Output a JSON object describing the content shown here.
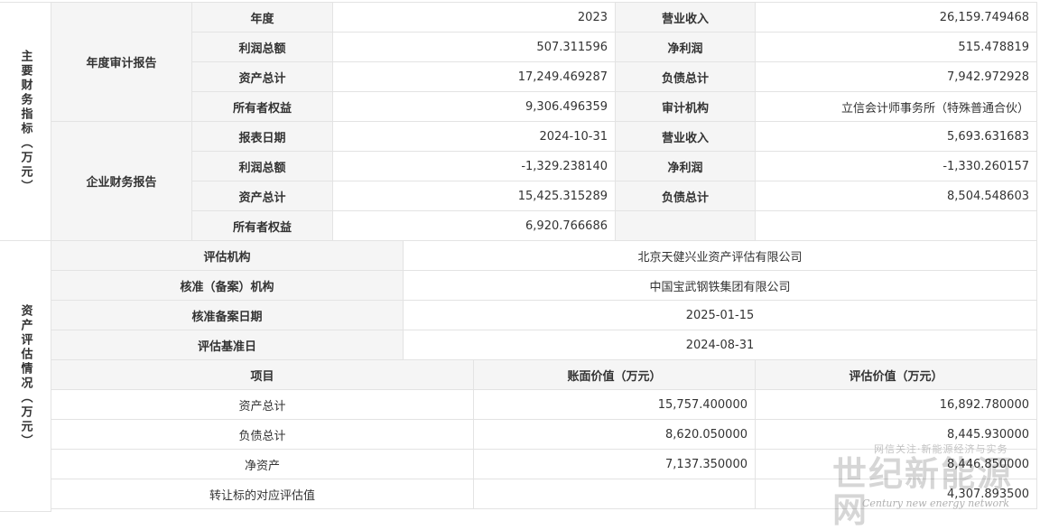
{
  "financial": {
    "group_label": "主要财务指标（万元）",
    "annual": {
      "label": "年度审计报告",
      "rows": [
        {
          "k1": "年度",
          "v1": "2023",
          "k2": "营业收入",
          "v2": "26,159.749468"
        },
        {
          "k1": "利润总额",
          "v1": "507.311596",
          "k2": "净利润",
          "v2": "515.478819"
        },
        {
          "k1": "资产总计",
          "v1": "17,249.469287",
          "k2": "负债总计",
          "v2": "7,942.972928"
        },
        {
          "k1": "所有者权益",
          "v1": "9,306.496359",
          "k2": "审计机构",
          "v2": "立信会计师事务所（特殊普通合伙）"
        }
      ]
    },
    "report": {
      "label": "企业财务报告",
      "rows": [
        {
          "k1": "报表日期",
          "v1": "2024-10-31",
          "k2": "营业收入",
          "v2": "5,693.631683"
        },
        {
          "k1": "利润总额",
          "v1": "-1,329.238140",
          "k2": "净利润",
          "v2": "-1,330.260157"
        },
        {
          "k1": "资产总计",
          "v1": "15,425.315289",
          "k2": "负债总计",
          "v2": "8,504.548603"
        },
        {
          "k1": "所有者权益",
          "v1": "6,920.766686",
          "k2": "",
          "v2": ""
        }
      ]
    }
  },
  "valuation": {
    "group_label": "资产评估情况（万元）",
    "info": [
      {
        "label": "评估机构",
        "value": "北京天健兴业资产评估有限公司"
      },
      {
        "label": "核准（备案）机构",
        "value": "中国宝武钢铁集团有限公司"
      },
      {
        "label": "核准备案日期",
        "value": "2025-01-15"
      },
      {
        "label": "评估基准日",
        "value": "2024-08-31"
      }
    ],
    "columns": [
      "项目",
      "账面价值（万元）",
      "评估价值（万元）"
    ],
    "rows": [
      {
        "item": "资产总计",
        "book": "15,757.400000",
        "appraised": "16,892.780000"
      },
      {
        "item": "负债总计",
        "book": "8,620.050000",
        "appraised": "8,445.930000"
      },
      {
        "item": "净资产",
        "book": "7,137.350000",
        "appraised": "8,446.850000"
      },
      {
        "item": "转让标的对应评估值",
        "book": "",
        "appraised": "4,307.893500"
      }
    ]
  },
  "watermark": {
    "top": "网信关注·新能源经济与实务",
    "main": "世纪新能源网",
    "sub": "Century new energy network"
  }
}
